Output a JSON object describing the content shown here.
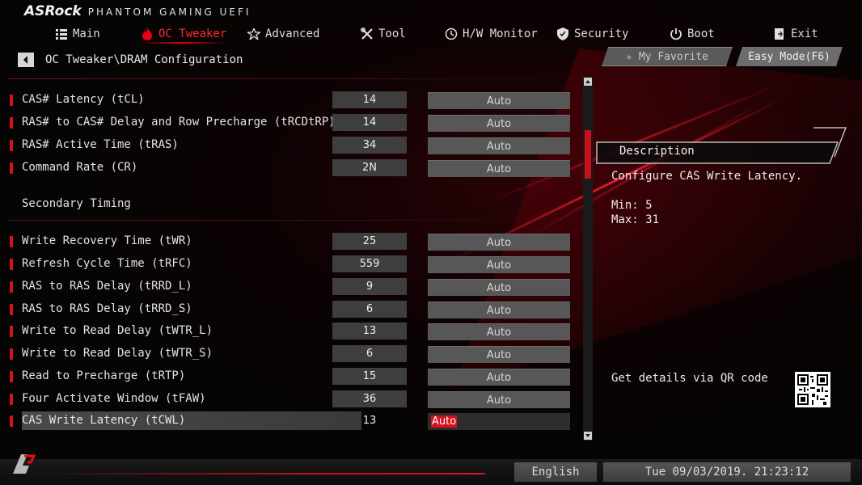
{
  "brand": {
    "logo": "ASRock",
    "subtitle": "PHANTOM GAMING UEFI"
  },
  "nav": {
    "items": [
      {
        "label": "Main",
        "icon": "list-icon",
        "active": false
      },
      {
        "label": "OC Tweaker",
        "icon": "flame-icon",
        "active": true
      },
      {
        "label": "Advanced",
        "icon": "star-icon",
        "active": false
      },
      {
        "label": "Tool",
        "icon": "tools-icon",
        "active": false
      },
      {
        "label": "H/W Monitor",
        "icon": "monitor-icon",
        "active": false
      },
      {
        "label": "Security",
        "icon": "shield-icon",
        "active": false
      },
      {
        "label": "Boot",
        "icon": "power-icon",
        "active": false
      },
      {
        "label": "Exit",
        "icon": "exit-icon",
        "active": false
      }
    ]
  },
  "breadcrumb": "OC Tweaker\\DRAM Configuration",
  "buttons": {
    "favorite": "My Favorite",
    "easy_mode": "Easy Mode(F6)"
  },
  "primary_rows": [
    {
      "label": "CAS# Latency (tCL)",
      "value": "14",
      "option": "Auto"
    },
    {
      "label": "RAS# to CAS# Delay and Row Precharge (tRCDtRP)",
      "value": "14",
      "option": "Auto"
    },
    {
      "label": "RAS# Active Time (tRAS)",
      "value": "34",
      "option": "Auto"
    },
    {
      "label": "Command Rate (CR)",
      "value": "2N",
      "option": "Auto"
    }
  ],
  "section_title": "Secondary Timing",
  "secondary_rows": [
    {
      "label": "Write Recovery Time (tWR)",
      "value": "25",
      "option": "Auto"
    },
    {
      "label": "Refresh Cycle Time (tRFC)",
      "value": "559",
      "option": "Auto"
    },
    {
      "label": "RAS to RAS Delay (tRRD_L)",
      "value": "9",
      "option": "Auto"
    },
    {
      "label": "RAS to RAS Delay (tRRD_S)",
      "value": "6",
      "option": "Auto"
    },
    {
      "label": "Write to Read Delay (tWTR_L)",
      "value": "13",
      "option": "Auto"
    },
    {
      "label": "Write to Read Delay (tWTR_S)",
      "value": "6",
      "option": "Auto"
    },
    {
      "label": "Read to Precharge (tRTP)",
      "value": "15",
      "option": "Auto"
    },
    {
      "label": "Four Activate Window (tFAW)",
      "value": "36",
      "option": "Auto"
    },
    {
      "label": "CAS Write Latency (tCWL)",
      "value": "13",
      "option": "Auto",
      "selected": true
    }
  ],
  "description": {
    "title": "Description",
    "text": "Configure CAS Write Latency.",
    "min": "Min: 5",
    "max": "Max: 31",
    "qr_label": "Get details via QR code"
  },
  "footer": {
    "language": "English",
    "datetime": "Tue 09/03/2019. 21:23:12"
  },
  "colors": {
    "accent": "#d4111d",
    "active_nav": "#ff2a2a",
    "value_bg": "#3e3e3e",
    "option_bg": "#575757"
  }
}
